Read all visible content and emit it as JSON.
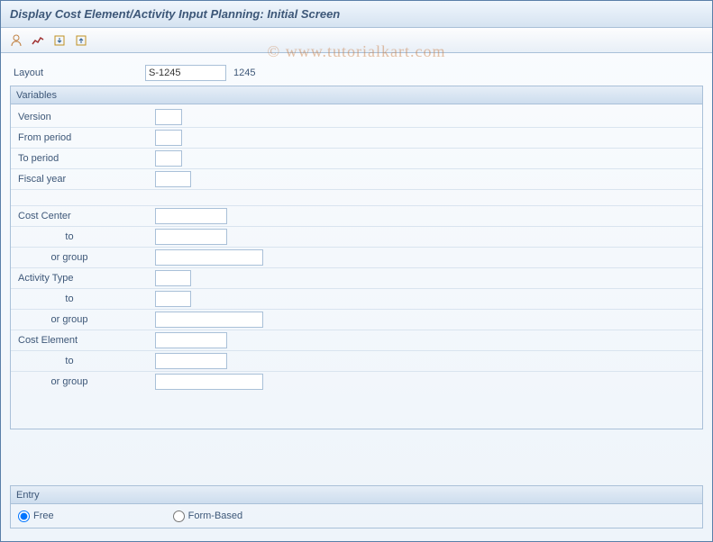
{
  "titlebar": {
    "title": "Display Cost Element/Activity Input Planning: Initial Screen"
  },
  "toolbar": {
    "icons": [
      "person-icon",
      "chart-icon",
      "import-icon",
      "export-icon"
    ]
  },
  "layout": {
    "label": "Layout",
    "value": "S-1245",
    "desc": "1245"
  },
  "variables": {
    "header": "Variables",
    "version_label": "Version",
    "version_value": "",
    "from_period_label": "From period",
    "from_period_value": "",
    "to_period_label": "To period",
    "to_period_value": "",
    "fiscal_year_label": "Fiscal year",
    "fiscal_year_value": "",
    "cost_center_label": "Cost Center",
    "cost_center_value": "",
    "cost_center_to_label": "to",
    "cost_center_to_value": "",
    "cost_center_group_label": "or group",
    "cost_center_group_value": "",
    "activity_type_label": "Activity Type",
    "activity_type_value": "",
    "activity_type_to_label": "to",
    "activity_type_to_value": "",
    "activity_type_group_label": "or group",
    "activity_type_group_value": "",
    "cost_element_label": "Cost Element",
    "cost_element_value": "",
    "cost_element_to_label": "to",
    "cost_element_to_value": "",
    "cost_element_group_label": "or group",
    "cost_element_group_value": ""
  },
  "entry": {
    "header": "Entry",
    "free_label": "Free",
    "form_label": "Form-Based",
    "selected": "free"
  },
  "watermark": "© www.tutorialkart.com"
}
